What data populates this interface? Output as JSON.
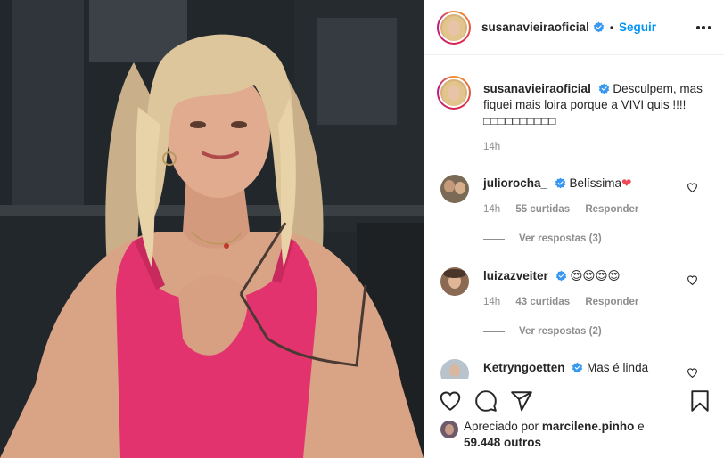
{
  "header": {
    "username": "susanavieiraoficial",
    "separator": "•",
    "follow_label": "Seguir"
  },
  "caption": {
    "username": "susanavieiraoficial",
    "text": "Desculpem, mas fiquei mais loira porque a VIVI quis !!!! ",
    "emojis": "□□□□□□□□□□",
    "time": "14h"
  },
  "comments": [
    {
      "username": "juliorocha_",
      "text": "Belíssima",
      "emoji": "❤",
      "time": "14h",
      "likes": "55 curtidas",
      "reply_label": "Responder",
      "view_replies": "Ver respostas (3)"
    },
    {
      "username": "luizazveiter",
      "text": "😍😍😍😍",
      "time": "14h",
      "likes": "43 curtidas",
      "reply_label": "Responder",
      "view_replies": "Ver respostas (2)"
    },
    {
      "username": "Ketryngoetten",
      "text": "Mas é linda"
    }
  ],
  "liked_by": {
    "prefix": "Apreciado por",
    "user": "marcilene.pinho",
    "conj": "e",
    "others": "59.448 outros"
  },
  "colors": {
    "link_blue": "#0095f6",
    "verified_blue": "#3897f0",
    "muted": "#8e8e8e",
    "heart_red": "#ed4956"
  },
  "icons": [
    "more-icon",
    "verified-icon",
    "heart-icon",
    "comment-icon",
    "share-icon",
    "save-icon"
  ]
}
